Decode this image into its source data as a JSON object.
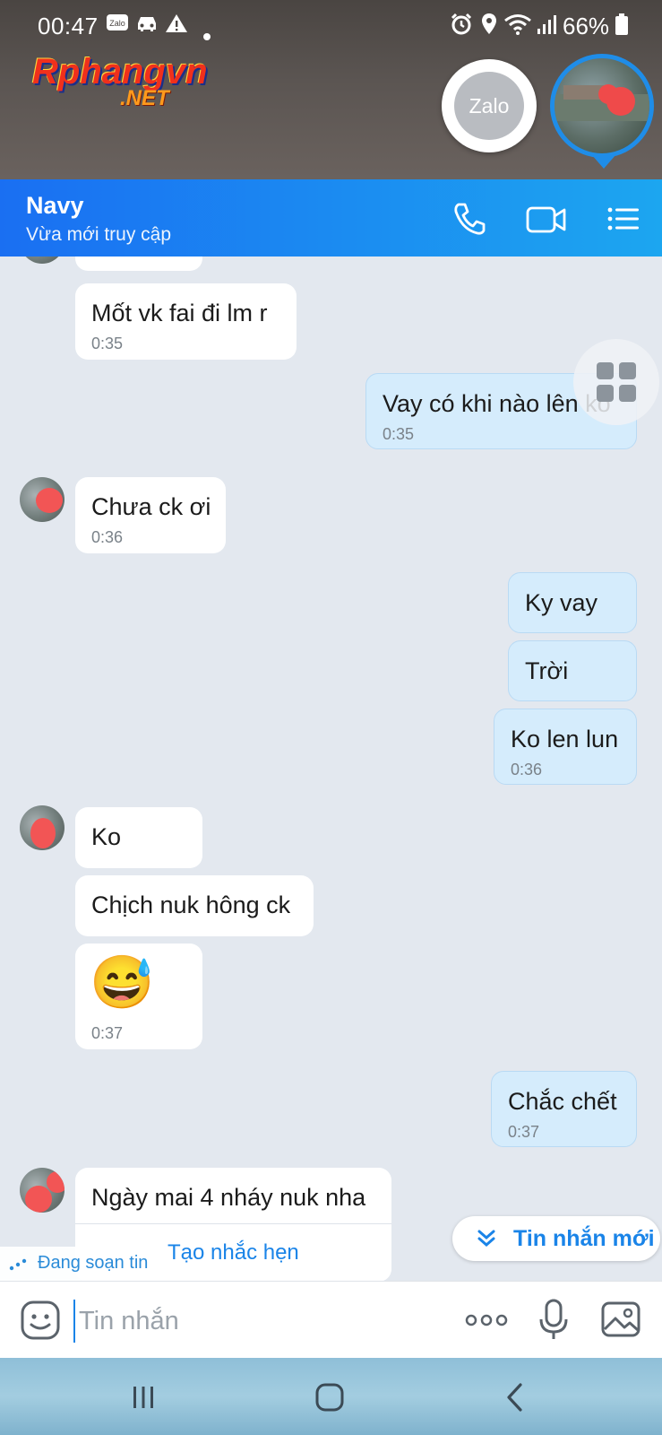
{
  "status_bar": {
    "time": "00:47",
    "notif_zalo": "Zalo",
    "battery": "66%"
  },
  "watermark": {
    "main": "Rphangvn",
    "sub": ".NET"
  },
  "floating": {
    "zalo_label": "Zalo"
  },
  "header": {
    "name": "Navy",
    "status": "Vừa mới truy cập"
  },
  "messages": [
    {
      "dir": "recv",
      "text": "Mốt vk fai đi lm r",
      "time": "0:35"
    },
    {
      "dir": "sent",
      "text": "Vay có khi nào lên ko",
      "time": "0:35"
    },
    {
      "dir": "recv",
      "text": "Chưa ck ơi",
      "time": "0:36"
    },
    {
      "dir": "sent",
      "text": "Ky vay",
      "time": ""
    },
    {
      "dir": "sent",
      "text": "Trời",
      "time": ""
    },
    {
      "dir": "sent",
      "text": "Ko len lun",
      "time": "0:36"
    },
    {
      "dir": "recv",
      "text": "Ko",
      "time": ""
    },
    {
      "dir": "recv",
      "text": "Chịch nuk hông ck",
      "time": ""
    },
    {
      "dir": "recv",
      "text": "😅",
      "time": "0:37"
    },
    {
      "dir": "sent",
      "text": "Chắc chết",
      "time": "0:37"
    },
    {
      "dir": "recv",
      "text": "Ngày mai 4 nháy nuk nha",
      "time": ""
    }
  ],
  "reminder": "Tạo nhắc hẹn",
  "typing": "Đang soạn tin",
  "new_messages": "Tin nhắn mới",
  "input": {
    "placeholder": "Tin nhắn"
  },
  "colors": {
    "header_start": "#1a6ff2",
    "header_end": "#1ca6f0",
    "sent_bubble": "#d5ecfc",
    "recv_bubble": "#ffffff",
    "chat_bg": "#e3e8ef",
    "accent": "#1a84e8"
  }
}
